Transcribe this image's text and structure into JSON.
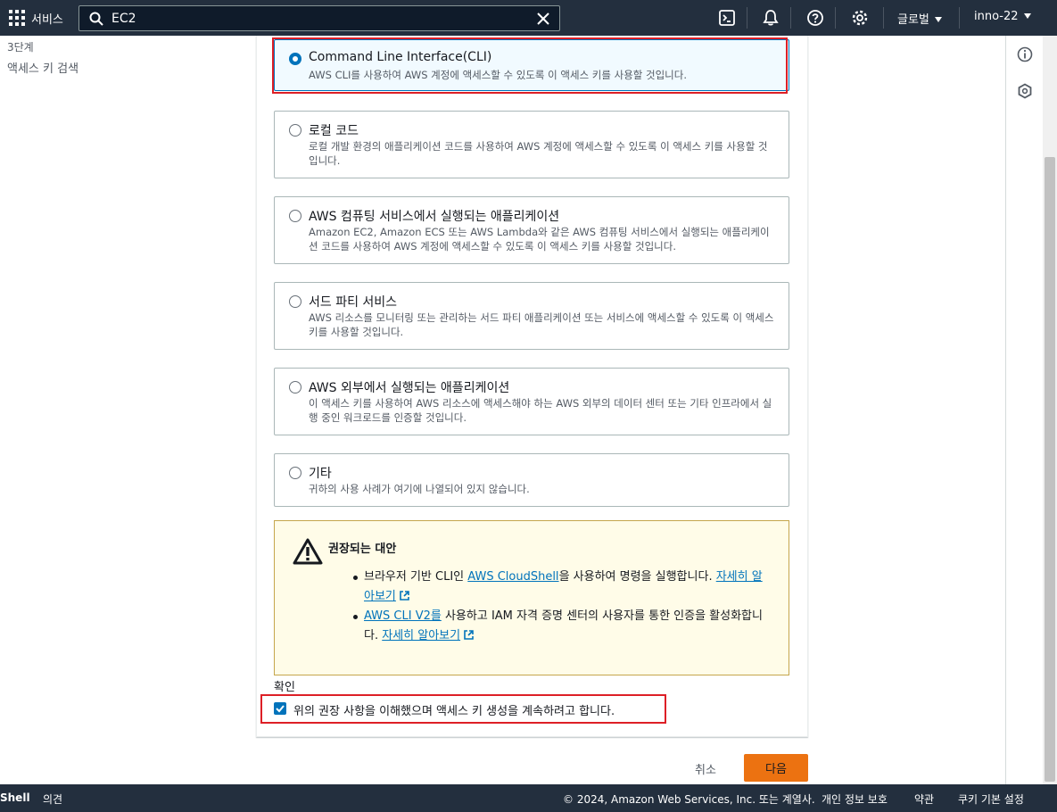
{
  "topnav": {
    "services_label": "서비스",
    "search_value": "EC2",
    "region_label": "글로벌",
    "account_label": "inno-22"
  },
  "sidebar": {
    "step_label": "3단계",
    "page_title": "액세스 키 검색"
  },
  "options": [
    {
      "title": "Command Line Interface(CLI)",
      "description": "AWS CLI를 사용하여 AWS 계정에 액세스할 수 있도록 이 액세스 키를 사용할 것입니다.",
      "selected": true
    },
    {
      "title": "로컬 코드",
      "description": "로컬 개발 환경의 애플리케이션 코드를 사용하여 AWS 계정에 액세스할 수 있도록 이 액세스 키를 사용할 것입니다.",
      "selected": false
    },
    {
      "title": "AWS 컴퓨팅 서비스에서 실행되는 애플리케이션",
      "description": "Amazon EC2, Amazon ECS 또는 AWS Lambda와 같은 AWS 컴퓨팅 서비스에서 실행되는 애플리케이션 코드를 사용하여 AWS 계정에 액세스할 수 있도록 이 액세스 키를 사용할 것입니다.",
      "selected": false
    },
    {
      "title": "서드 파티 서비스",
      "description": "AWS 리소스를 모니터링 또는 관리하는 서드 파티 애플리케이션 또는 서비스에 액세스할 수 있도록 이 액세스 키를 사용할 것입니다.",
      "selected": false
    },
    {
      "title": "AWS 외부에서 실행되는 애플리케이션",
      "description": "이 액세스 키를 사용하여 AWS 리소스에 액세스해야 하는 AWS 외부의 데이터 센터 또는 기타 인프라에서 실행 중인 워크로드를 인증할 것입니다.",
      "selected": false
    },
    {
      "title": "기타",
      "description": "귀하의 사용 사례가 여기에 나열되어 있지 않습니다.",
      "selected": false
    }
  ],
  "alert": {
    "title": "권장되는 대안",
    "item1_prefix": "브라우저 기반 CLI인 ",
    "item1_link": "AWS CloudShell",
    "item1_middle": "을 사용하여 명령을 실행합니다. ",
    "item1_learn_more": "자세히 알아보기",
    "item2_link": "AWS CLI V2를",
    "item2_middle": " 사용하고 IAM 자격 증명 센터의 사용자를 통한 인증을 활성화합니다. ",
    "item2_learn_more": "자세히 알아보기"
  },
  "confirm": {
    "label": "확인",
    "checkbox_text": "위의 권장 사항을 이해했으며 액세스 키 생성을 계속하려고 합니다.",
    "checked": true
  },
  "actions": {
    "cancel_label": "취소",
    "next_label": "다음"
  },
  "footer": {
    "cloudshell_label": "Shell",
    "feedback_label": "의견",
    "copyright": "© 2024, Amazon Web Services, Inc. 또는 계열사.",
    "privacy_label": "개인 정보 보호",
    "terms_label": "약관",
    "cookie_label": "쿠키 기본 설정"
  },
  "colors": {
    "nav_bg": "#232f3e",
    "accent_blue": "#0073bb",
    "primary_orange": "#ec7211",
    "highlight_red": "#dd1f26",
    "warning_bg": "#fffce8"
  }
}
